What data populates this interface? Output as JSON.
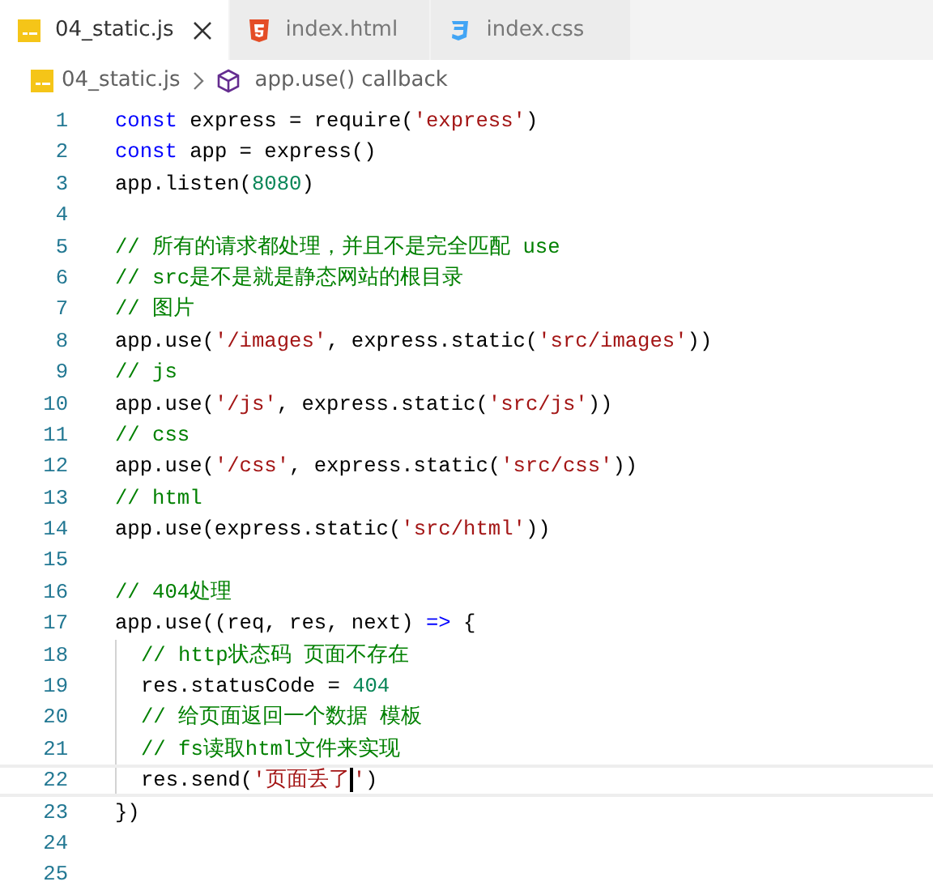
{
  "tabs": [
    {
      "label": "04_static.js",
      "kind": "js",
      "selected": true
    },
    {
      "label": "index.html",
      "kind": "html",
      "selected": false
    },
    {
      "label": "index.css",
      "kind": "css",
      "selected": false
    }
  ],
  "breadcrumb": {
    "file": "04_static.js",
    "symbol": "app.use() callback"
  },
  "lines": [
    {
      "number": "1",
      "indented": false,
      "current": false,
      "tokens": [
        {
          "text": "const",
          "kind": "keyword"
        },
        {
          "text": " express = require(",
          "kind": "plain"
        },
        {
          "text": "'express'",
          "kind": "string"
        },
        {
          "text": ")",
          "kind": "plain"
        }
      ]
    },
    {
      "number": "2",
      "indented": false,
      "current": false,
      "tokens": [
        {
          "text": "const",
          "kind": "keyword"
        },
        {
          "text": " app = express()",
          "kind": "plain"
        }
      ]
    },
    {
      "number": "3",
      "indented": false,
      "current": false,
      "tokens": [
        {
          "text": "app.listen(",
          "kind": "plain"
        },
        {
          "text": "8080",
          "kind": "number"
        },
        {
          "text": ")",
          "kind": "plain"
        }
      ]
    },
    {
      "number": "4",
      "indented": false,
      "current": false
    },
    {
      "number": "5",
      "indented": false,
      "current": false,
      "tokens": [
        {
          "text": "// 所有的请求都处理，并且不是完全匹配 use",
          "kind": "comment"
        }
      ]
    },
    {
      "number": "6",
      "indented": false,
      "current": false,
      "tokens": [
        {
          "text": "// src是不是就是静态网站的根目录",
          "kind": "comment"
        }
      ]
    },
    {
      "number": "7",
      "indented": false,
      "current": false,
      "tokens": [
        {
          "text": "// 图片",
          "kind": "comment"
        }
      ]
    },
    {
      "number": "8",
      "indented": false,
      "current": false,
      "tokens": [
        {
          "text": "app.use(",
          "kind": "plain"
        },
        {
          "text": "'/images'",
          "kind": "string"
        },
        {
          "text": ", express.static(",
          "kind": "plain"
        },
        {
          "text": "'src/images'",
          "kind": "string"
        },
        {
          "text": "))",
          "kind": "plain"
        }
      ]
    },
    {
      "number": "9",
      "indented": false,
      "current": false,
      "tokens": [
        {
          "text": "// js",
          "kind": "comment"
        }
      ]
    },
    {
      "number": "10",
      "indented": false,
      "current": false,
      "tokens": [
        {
          "text": "app.use(",
          "kind": "plain"
        },
        {
          "text": "'/js'",
          "kind": "string"
        },
        {
          "text": ", express.static(",
          "kind": "plain"
        },
        {
          "text": "'src/js'",
          "kind": "string"
        },
        {
          "text": "))",
          "kind": "plain"
        }
      ]
    },
    {
      "number": "11",
      "indented": false,
      "current": false,
      "tokens": [
        {
          "text": "// css",
          "kind": "comment"
        }
      ]
    },
    {
      "number": "12",
      "indented": false,
      "current": false,
      "tokens": [
        {
          "text": "app.use(",
          "kind": "plain"
        },
        {
          "text": "'/css'",
          "kind": "string"
        },
        {
          "text": ", express.static(",
          "kind": "plain"
        },
        {
          "text": "'src/css'",
          "kind": "string"
        },
        {
          "text": "))",
          "kind": "plain"
        }
      ]
    },
    {
      "number": "13",
      "indented": false,
      "current": false,
      "tokens": [
        {
          "text": "// html",
          "kind": "comment"
        }
      ]
    },
    {
      "number": "14",
      "indented": false,
      "current": false,
      "tokens": [
        {
          "text": "app.use(express.static(",
          "kind": "plain"
        },
        {
          "text": "'src/html'",
          "kind": "string"
        },
        {
          "text": "))",
          "kind": "plain"
        }
      ]
    },
    {
      "number": "15",
      "indented": false,
      "current": false
    },
    {
      "number": "16",
      "indented": false,
      "current": false,
      "tokens": [
        {
          "text": "// 404处理",
          "kind": "comment"
        }
      ]
    },
    {
      "number": "17",
      "indented": false,
      "current": false,
      "tokens": [
        {
          "text": "app.use((req, res, next) ",
          "kind": "plain"
        },
        {
          "text": "=>",
          "kind": "keyword"
        },
        {
          "text": " {",
          "kind": "plain"
        }
      ]
    },
    {
      "number": "18",
      "indented": true,
      "current": false,
      "tokens": [
        {
          "text": "// http状态码 页面不存在",
          "kind": "comment"
        }
      ]
    },
    {
      "number": "19",
      "indented": true,
      "current": false,
      "tokens": [
        {
          "text": "res.statusCode = ",
          "kind": "plain"
        },
        {
          "text": "404",
          "kind": "number"
        }
      ]
    },
    {
      "number": "20",
      "indented": true,
      "current": false,
      "tokens": [
        {
          "text": "// 给页面返回一个数据 模板",
          "kind": "comment"
        }
      ]
    },
    {
      "number": "21",
      "indented": true,
      "current": false,
      "tokens": [
        {
          "text": "// fs读取html文件来实现",
          "kind": "comment"
        }
      ]
    },
    {
      "number": "22",
      "indented": true,
      "current": true,
      "tokens": [
        {
          "text": "res.send(",
          "kind": "plain"
        },
        {
          "text": "'页面丢了'",
          "kind": "string"
        },
        {
          "text": ")",
          "kind": "plain"
        }
      ]
    },
    {
      "number": "23",
      "indented": false,
      "current": false,
      "tokens": [
        {
          "text": "})",
          "kind": "plain"
        }
      ]
    },
    {
      "number": "24",
      "indented": false,
      "current": false
    },
    {
      "number": "25",
      "indented": false,
      "current": false
    }
  ]
}
